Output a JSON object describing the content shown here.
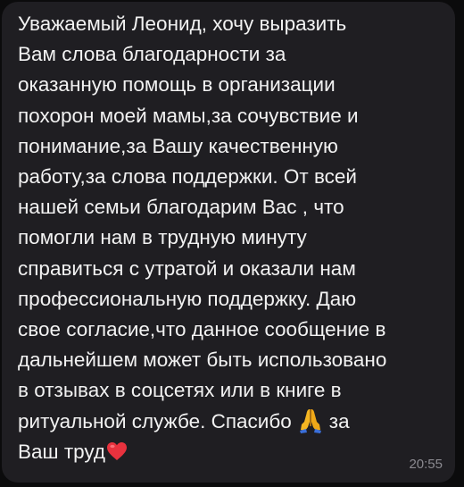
{
  "message": {
    "lines": [
      "Уважаемый Леонид, хочу выразить",
      "Вам слова благодарности за",
      "оказанную помощь в организации",
      "похорон моей мамы,за сочувствие и",
      "понимание,за Вашу качественную",
      "работу,за слова поддержки. От всей",
      "нашей семьи благодарим Вас , что",
      "помогли нам в трудную минуту",
      "справиться с утратой и оказали нам",
      "профессиональную поддержку.  Даю",
      "свое согласие,что данное сообщение в",
      "дальнейшем может быть использовано",
      "в отзывах в соцсетях или в книге в",
      "ритуальной службе. Спасибо",
      "за",
      "Ваш труд"
    ],
    "emoji": {
      "pray": "folded-hands-icon",
      "heart": "red-heart-icon"
    },
    "time": "20:55"
  },
  "colors": {
    "background": "#0b0b0c",
    "bubble": "#1f1e22",
    "text": "#f2f2f2",
    "time": "#8b8a90",
    "heart": "#e8323e",
    "pray": "#f5b622"
  }
}
